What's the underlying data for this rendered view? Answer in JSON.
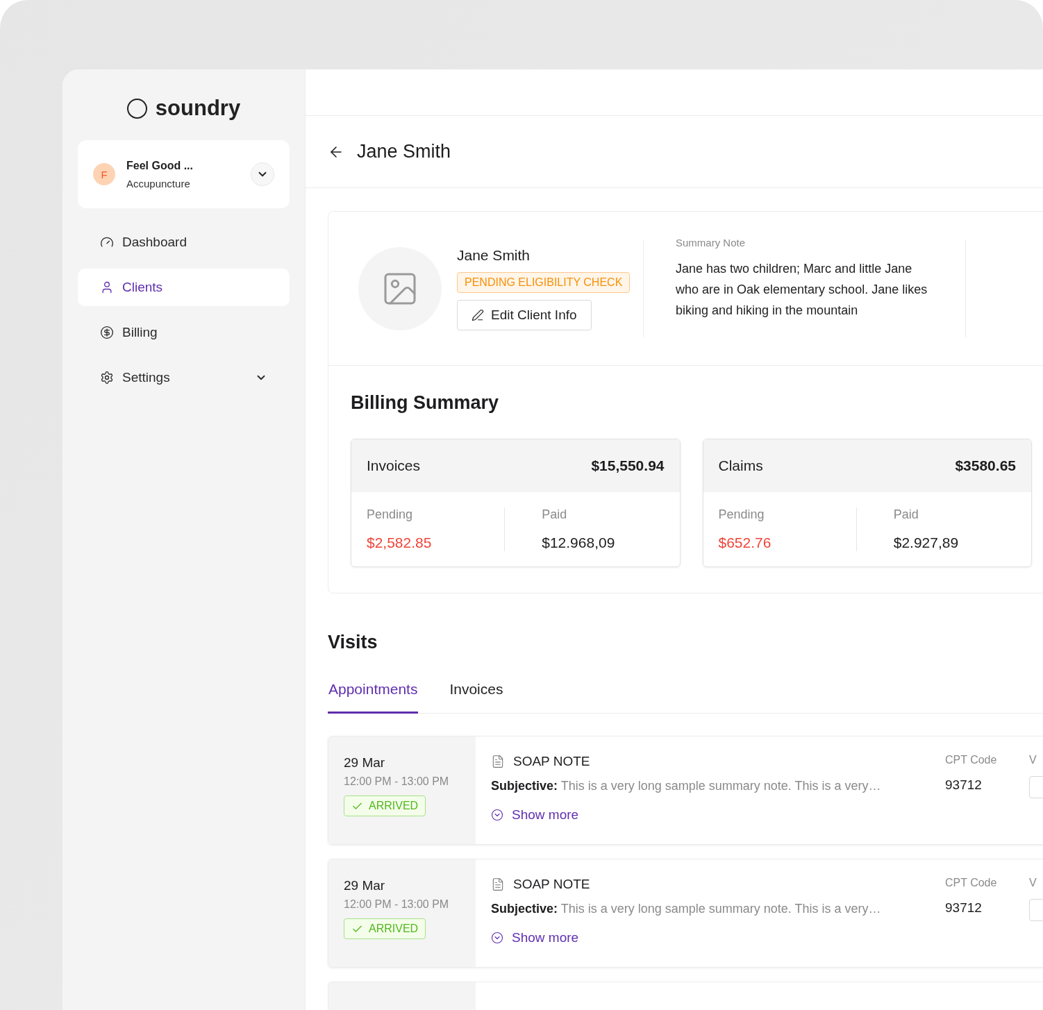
{
  "brand": {
    "name": "soundry"
  },
  "organization": {
    "initial": "F",
    "name": "Feel Good ...",
    "subtitle": "Accupuncture"
  },
  "nav": [
    {
      "label": "Dashboard",
      "selected": false,
      "expandable": false
    },
    {
      "label": "Clients",
      "selected": true,
      "expandable": false
    },
    {
      "label": "Billing",
      "selected": false,
      "expandable": false
    },
    {
      "label": "Settings",
      "selected": false,
      "expandable": true
    }
  ],
  "header": {
    "title": "Jane Smith"
  },
  "client": {
    "name": "Jane Smith",
    "status": "PENDING ELIGIBILITY CHECK",
    "edit_button": "Edit Client Info",
    "note_label": "Summary Note",
    "note": "Jane has two children; Marc and little Jane who are in Oak elementary school. Jane likes biking and hiking in the mountain"
  },
  "billing": {
    "title": "Billing Summary",
    "cards": [
      {
        "title": "Invoices",
        "total": "$15,550.94",
        "pending_label": "Pending",
        "pending": "$2,582.85",
        "paid_label": "Paid",
        "paid": "$12.968,09"
      },
      {
        "title": "Claims",
        "total": "$3580.65",
        "pending_label": "Pending",
        "pending": "$652.76",
        "paid_label": "Paid",
        "paid": "$2.927,89"
      }
    ]
  },
  "visits": {
    "title": "Visits",
    "tabs": [
      {
        "label": "Appointments",
        "selected": true
      },
      {
        "label": "Invoices",
        "selected": false
      }
    ],
    "more_rows": true,
    "items": [
      {
        "date": "29 Mar",
        "time": "12:00 PM - 13:00 PM",
        "status": "ARRIVED",
        "note_type": "SOAP NOTE",
        "summary": "**Subjective:** This is a very long sample summary note. This is a very…",
        "action": "Show more",
        "cpt_label": "CPT Code",
        "cpt_code": "93712",
        "column_4": "V"
      },
      {
        "date": "29 Mar",
        "time": "12:00 PM - 13:00 PM",
        "status": "ARRIVED",
        "note_type": "SOAP NOTE",
        "summary": "**Subjective:** This is a very long sample summary note. This is a very…",
        "action": "Show more",
        "cpt_label": "CPT Code",
        "cpt_code": "93712",
        "column_4": "V"
      }
    ]
  }
}
